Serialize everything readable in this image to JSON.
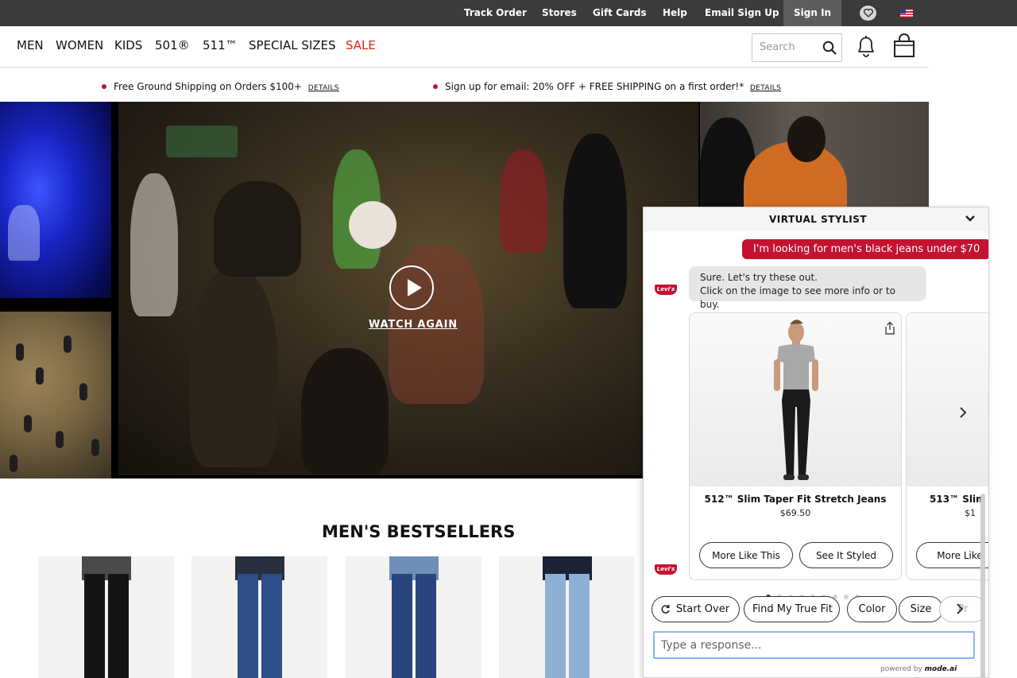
{
  "utility_bar": {
    "links": [
      "Track Order",
      "Stores",
      "Gift Cards",
      "Help",
      "Email Sign Up"
    ],
    "sign_in": "Sign In"
  },
  "nav": {
    "items": [
      "MEN",
      "WOMEN",
      "KIDS",
      "501®",
      "511™",
      "SPECIAL SIZES"
    ],
    "sale": "SALE",
    "search_placeholder": "Search"
  },
  "promos": [
    {
      "text": "Free Ground Shipping on Orders $100+",
      "details": "DETAILS"
    },
    {
      "text": "Sign up for email: 20% OFF + FREE SHIPPING on a first order!*",
      "details": "DETAILS"
    }
  ],
  "hero": {
    "cta": "WATCH AGAIN"
  },
  "bestsellers": {
    "title": "MEN'S BESTSELLERS"
  },
  "stylist": {
    "title": "VIRTUAL STYLIST",
    "user_message": "I'm looking for men's black jeans under $70",
    "bot_logo": "Levi's",
    "bot_message_line1": "Sure. Let's try these out.",
    "bot_message_line2": "Click on the image to see more info or to buy.",
    "product1": {
      "name": "512™ Slim Taper Fit Stretch Jeans",
      "price": "$69.50",
      "more_like_this": "More Like This",
      "see_it_styled": "See It Styled"
    },
    "product2": {
      "name": "513™ Slim",
      "price": "$1",
      "more_like_this": "More Like"
    },
    "carousel_pages": 9,
    "carousel_active": 1,
    "chips": [
      "Start Over",
      "Find My True Fit",
      "Color",
      "Size",
      "Pr"
    ],
    "input_placeholder": "Type a response...",
    "powered_by": "powered by",
    "powered_brand": "mode.ai"
  },
  "colors": {
    "brand_red": "#c41230",
    "sale_red": "#e4201b",
    "utility_bar": "#3b3b3b",
    "input_focus": "#8ab4f0"
  }
}
